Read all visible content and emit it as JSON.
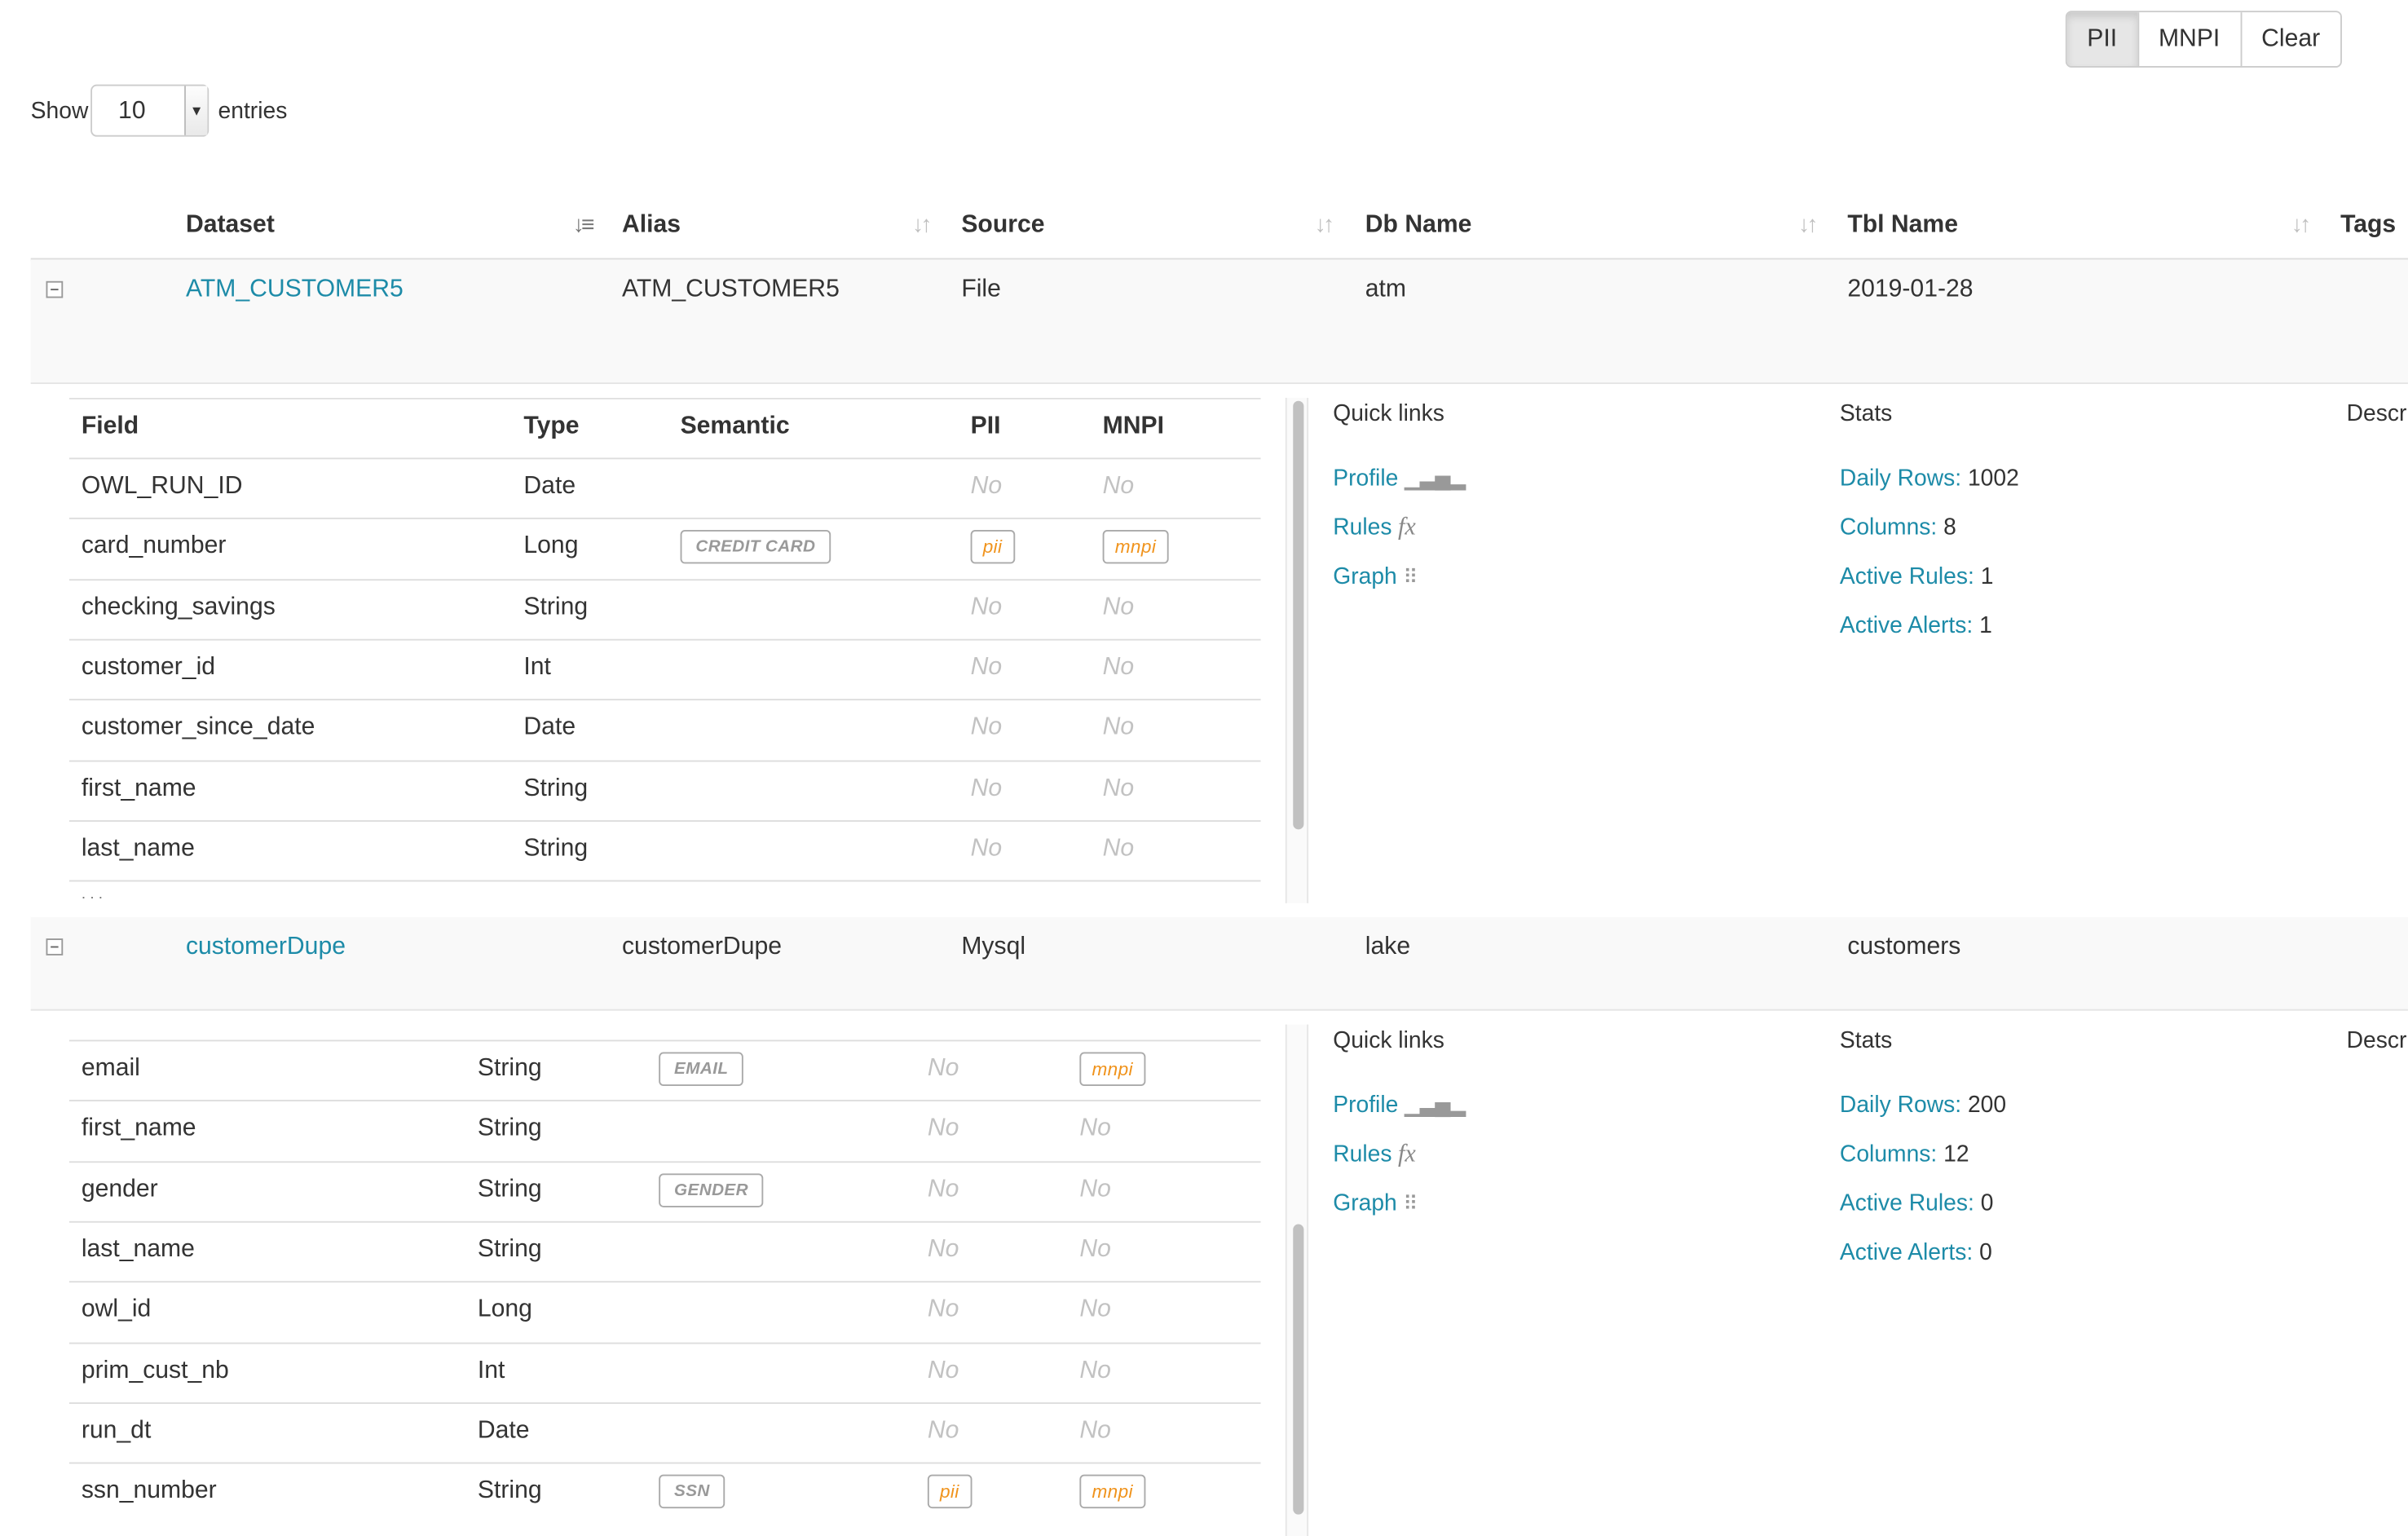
{
  "filters": {
    "buttons": [
      "PII",
      "MNPI",
      "Clear"
    ],
    "active": "PII"
  },
  "length": {
    "show_label": "Show",
    "value": "10",
    "entries_label": "entries"
  },
  "columns": [
    "Dataset",
    "Alias",
    "Source",
    "Db Name",
    "Tbl Name",
    "Tags"
  ],
  "datasets": [
    {
      "dataset": "ATM_CUSTOMER5",
      "alias": "ATM_CUSTOMER5",
      "source": "File",
      "db_name": "atm",
      "tbl_name": "2019-01-28",
      "fields_header": [
        "Field",
        "Type",
        "Semantic",
        "PII",
        "MNPI"
      ],
      "fields": [
        {
          "field": "OWL_RUN_ID",
          "type": "Date",
          "semantic": "",
          "pii": "No",
          "mnpi": "No"
        },
        {
          "field": "card_number",
          "type": "Long",
          "semantic": "CREDIT CARD",
          "pii": "pii",
          "mnpi": "mnpi"
        },
        {
          "field": "checking_savings",
          "type": "String",
          "semantic": "",
          "pii": "No",
          "mnpi": "No"
        },
        {
          "field": "customer_id",
          "type": "Int",
          "semantic": "",
          "pii": "No",
          "mnpi": "No"
        },
        {
          "field": "customer_since_date",
          "type": "Date",
          "semantic": "",
          "pii": "No",
          "mnpi": "No"
        },
        {
          "field": "first_name",
          "type": "String",
          "semantic": "",
          "pii": "No",
          "mnpi": "No"
        },
        {
          "field": "last_name",
          "type": "String",
          "semantic": "",
          "pii": "No",
          "mnpi": "No"
        }
      ],
      "quick_links_title": "Quick links",
      "links": {
        "profile": "Profile",
        "rules": "Rules",
        "rules_icon": "fx",
        "graph": "Graph"
      },
      "stats_title": "Stats",
      "description_title": "Descri",
      "stats": [
        {
          "label": "Daily Rows:",
          "value": "1002"
        },
        {
          "label": "Columns:",
          "value": "8"
        },
        {
          "label": "Active Rules:",
          "value": "1"
        },
        {
          "label": "Active Alerts:",
          "value": "1"
        }
      ]
    },
    {
      "dataset": "customerDupe",
      "alias": "customerDupe",
      "source": "Mysql",
      "db_name": "lake",
      "tbl_name": "customers",
      "fields": [
        {
          "field": "email",
          "type": "String",
          "semantic": "EMAIL",
          "pii": "No",
          "mnpi": "mnpi"
        },
        {
          "field": "first_name",
          "type": "String",
          "semantic": "",
          "pii": "No",
          "mnpi": "No"
        },
        {
          "field": "gender",
          "type": "String",
          "semantic": "GENDER",
          "pii": "No",
          "mnpi": "No"
        },
        {
          "field": "last_name",
          "type": "String",
          "semantic": "",
          "pii": "No",
          "mnpi": "No"
        },
        {
          "field": "owl_id",
          "type": "Long",
          "semantic": "",
          "pii": "No",
          "mnpi": "No"
        },
        {
          "field": "prim_cust_nb",
          "type": "Int",
          "semantic": "",
          "pii": "No",
          "mnpi": "No"
        },
        {
          "field": "run_dt",
          "type": "Date",
          "semantic": "",
          "pii": "No",
          "mnpi": "No"
        },
        {
          "field": "ssn_number",
          "type": "String",
          "semantic": "SSN",
          "pii": "pii",
          "mnpi": "mnpi"
        }
      ],
      "quick_links_title": "Quick links",
      "links": {
        "profile": "Profile",
        "rules": "Rules",
        "rules_icon": "fx",
        "graph": "Graph"
      },
      "stats_title": "Stats",
      "description_title": "Descri",
      "stats": [
        {
          "label": "Daily Rows:",
          "value": "200"
        },
        {
          "label": "Columns:",
          "value": "12"
        },
        {
          "label": "Active Rules:",
          "value": "0"
        },
        {
          "label": "Active Alerts:",
          "value": "0"
        }
      ]
    }
  ],
  "icons": {
    "profile": "bar-chart-icon",
    "graph": "sitemap-icon",
    "sort": "sort-icon",
    "toggle": "collapse-icon"
  },
  "colors": {
    "link": "#1d8ba8",
    "badge_orange": "#f0931c",
    "muted": "#c2c2c2"
  }
}
